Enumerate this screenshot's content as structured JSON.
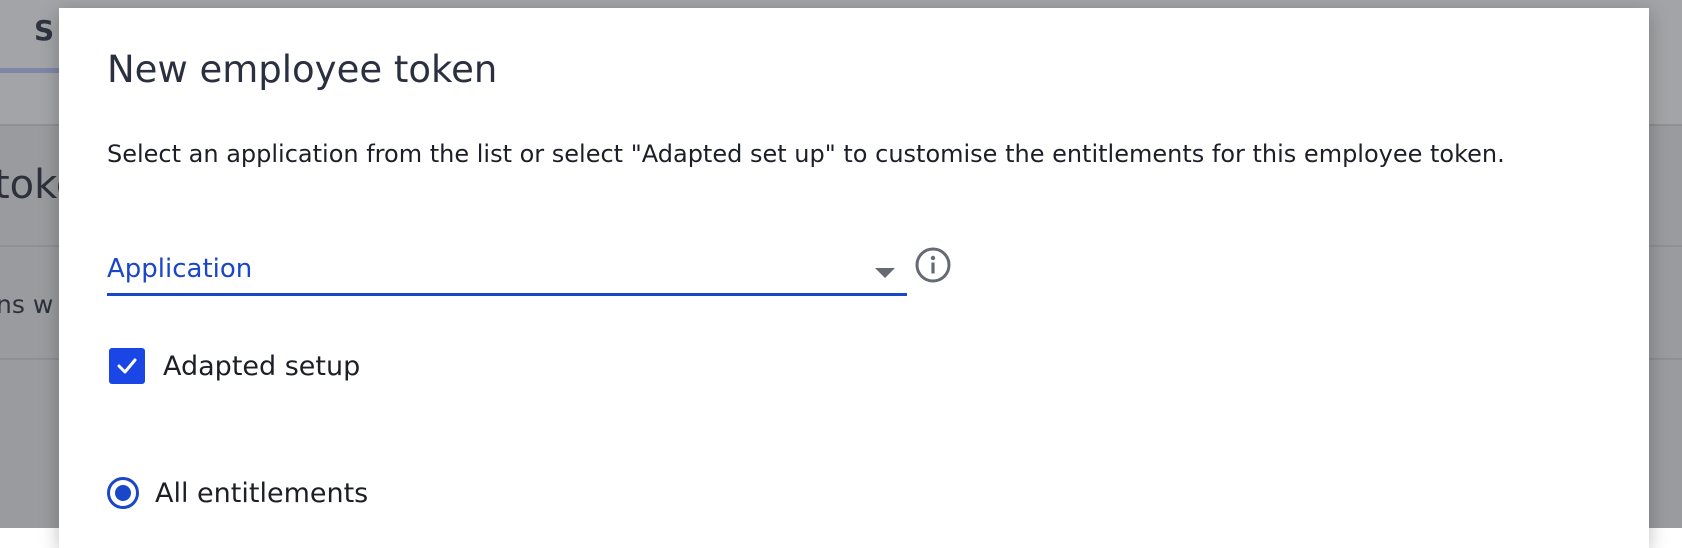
{
  "background": {
    "tab_label": "S",
    "heading": "toke",
    "text": "ns w"
  },
  "dialog": {
    "title": "New employee token",
    "description": "Select an application from the list or select \"Adapted set up\" to customise the entitlements for this employee token.",
    "application_select": {
      "label": "Application",
      "icon": "chevron-down-icon"
    },
    "info_icon": "info-icon",
    "adapted_setup": {
      "label": "Adapted setup",
      "checked": true
    },
    "entitlements_option": {
      "label": "All entitlements",
      "selected": true
    }
  },
  "colors": {
    "accent": "#1a46c9",
    "checkbox": "#1a46e6",
    "title": "#2b3040",
    "overlay": "#9a9b9e"
  }
}
